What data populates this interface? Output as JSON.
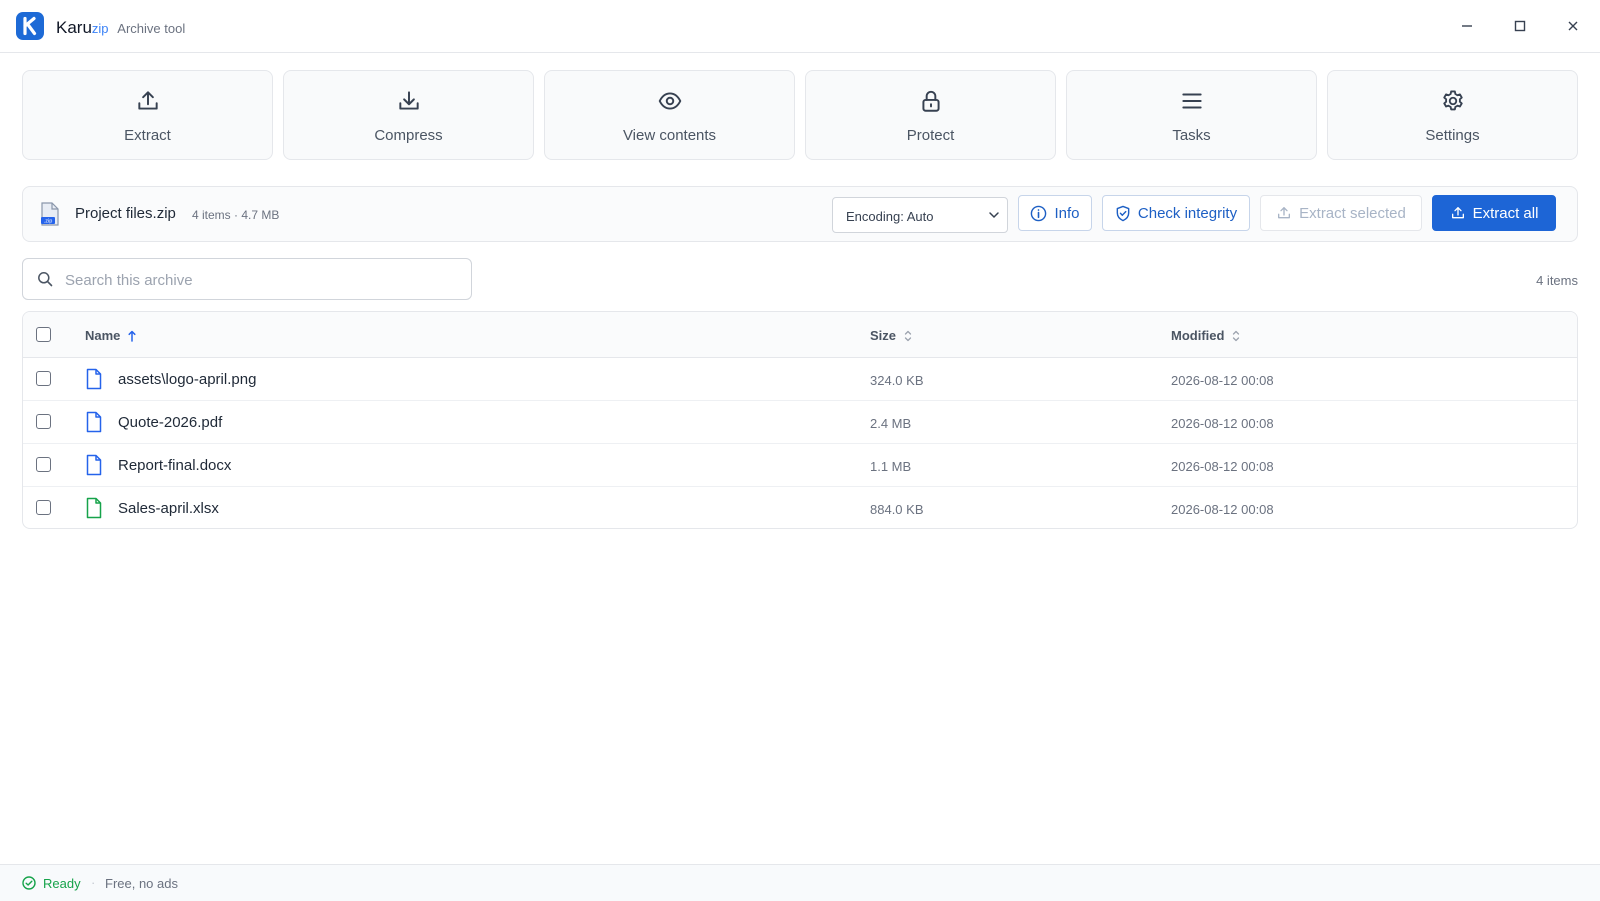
{
  "app": {
    "name": "Karu",
    "name_suffix": "zip",
    "subtitle": "Archive tool",
    "logo_letter": "K"
  },
  "window_controls": [
    "minimize",
    "maximize",
    "close"
  ],
  "tools": [
    {
      "label": "Extract",
      "icon": "upload-icon"
    },
    {
      "label": "Compress",
      "icon": "download-icon"
    },
    {
      "label": "View contents",
      "icon": "eye-icon"
    },
    {
      "label": "Protect",
      "icon": "lock-icon"
    },
    {
      "label": "Tasks",
      "icon": "list-icon"
    },
    {
      "label": "Settings",
      "icon": "gear-icon"
    }
  ],
  "archive": {
    "name": "Project files.zip",
    "meta": "4 items · 4.7 MB",
    "zip_badge": ".zip",
    "encoding": "Encoding: Auto",
    "info_label": "Info",
    "check_label": "Check integrity",
    "extract_selected_label": "Extract selected",
    "extract_all_label": "Extract all"
  },
  "search": {
    "placeholder": "Search this archive",
    "value": ""
  },
  "item_count": "4 items",
  "table": {
    "columns": {
      "name": "Name",
      "size": "Size",
      "modified": "Modified"
    },
    "sort": {
      "column": "name",
      "direction": "asc"
    },
    "rows": [
      {
        "name": "assets\\logo-april.png",
        "size": "324.0 KB",
        "modified": "2026-08-12 00:08",
        "icon_color": "#2563eb"
      },
      {
        "name": "Quote-2026.pdf",
        "size": "2.4 MB",
        "modified": "2026-08-12 00:08",
        "icon_color": "#2563eb"
      },
      {
        "name": "Report-final.docx",
        "size": "1.1 MB",
        "modified": "2026-08-12 00:08",
        "icon_color": "#2563eb"
      },
      {
        "name": "Sales-april.xlsx",
        "size": "884.0 KB",
        "modified": "2026-08-12 00:08",
        "icon_color": "#16a34a"
      }
    ]
  },
  "status": {
    "state": "Ready",
    "separator": "·",
    "note": "Free, no ads",
    "state_color": "#16a34a"
  },
  "colors": {
    "accent": "#1d65d6",
    "border": "#e5e7eb"
  }
}
